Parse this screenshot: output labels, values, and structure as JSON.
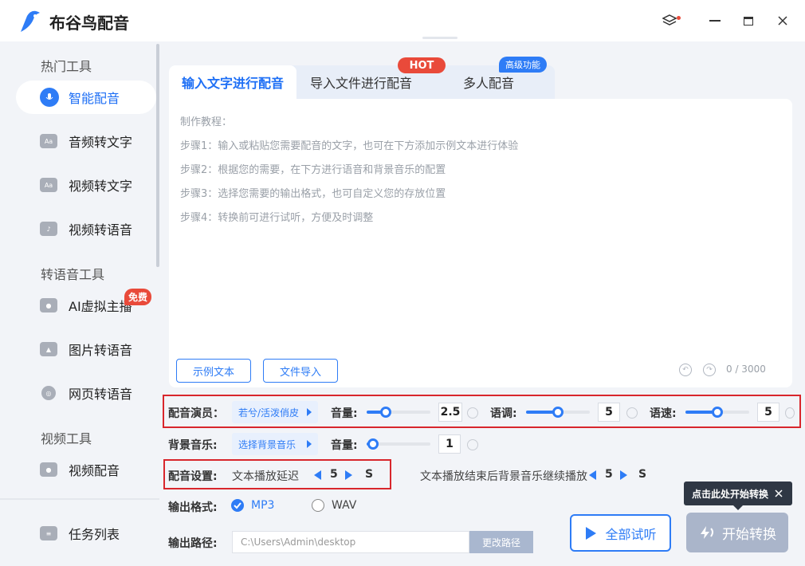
{
  "app": {
    "title": "布谷鸟配音"
  },
  "sidebar": {
    "sections": [
      {
        "title": "热门工具",
        "items": [
          {
            "label": "智能配音",
            "icon": "mic-icon",
            "active": true
          },
          {
            "label": "音频转文字",
            "icon": "audio-text-icon"
          },
          {
            "label": "视频转文字",
            "icon": "video-text-icon"
          },
          {
            "label": "视频转语音",
            "icon": "video-voice-icon"
          }
        ]
      },
      {
        "title": "转语音工具",
        "items": [
          {
            "label": "AI虚拟主播",
            "icon": "anchor-icon",
            "badge": "免费"
          },
          {
            "label": "图片转语音",
            "icon": "image-icon"
          },
          {
            "label": "网页转语音",
            "icon": "globe-icon"
          }
        ]
      },
      {
        "title": "视频工具",
        "items": [
          {
            "label": "视频配音",
            "icon": "video-mic-icon"
          }
        ]
      }
    ],
    "task_list": "任务列表"
  },
  "tabs": [
    {
      "label": "输入文字进行配音",
      "active": true
    },
    {
      "label": "导入文件进行配音",
      "badge": "HOT"
    },
    {
      "label": "多人配音",
      "badge": "高级功能"
    }
  ],
  "editor": {
    "hints": [
      "制作教程：",
      "步骤1：输入或粘贴您需要配音的文字，也可在下方添加示例文本进行体验",
      "步骤2：根据您的需要，在下方进行语音和背景音乐的配置",
      "步骤3：选择您需要的输出格式，也可自定义您的存放位置",
      "步骤4：转换前可进行试听，方便及时调整"
    ],
    "sample_button": "示例文本",
    "import_button": "文件导入",
    "char_count": "0 / 3000"
  },
  "voice": {
    "label": "配音演员：",
    "actor": "若兮/活泼俏皮",
    "volume_label": "音量:",
    "volume": "2.5",
    "volume_fraction": 0.3,
    "pitch_label": "语调:",
    "pitch": "5",
    "pitch_fraction": 0.5,
    "speed_label": "语速:",
    "speed": "5",
    "speed_fraction": 0.5
  },
  "bgm": {
    "label": "背景音乐:",
    "select": "选择背景音乐",
    "volume_label": "音量:",
    "volume": "1",
    "volume_fraction": 0.1
  },
  "settings": {
    "label": "配音设置:",
    "delay_label": "文本播放延迟",
    "delay": "5",
    "unit": "S",
    "continue_label": "文本播放结束后背景音乐继续播放",
    "continue_value": "5",
    "continue_unit": "S"
  },
  "output": {
    "format_label": "输出格式:",
    "formats": [
      {
        "label": "MP3",
        "checked": true
      },
      {
        "label": "WAV",
        "checked": false
      }
    ],
    "path_label": "输出路径:",
    "path": "C:\\Users\\Admin\\desktop",
    "change_path": "更改路径"
  },
  "actions": {
    "listen_all": "全部试听",
    "start": "开始转换",
    "tooltip": "点击此处开始转换"
  },
  "colors": {
    "accent": "#2e7cf6",
    "hot": "#e94a3a",
    "highlight": "#d8262c"
  }
}
